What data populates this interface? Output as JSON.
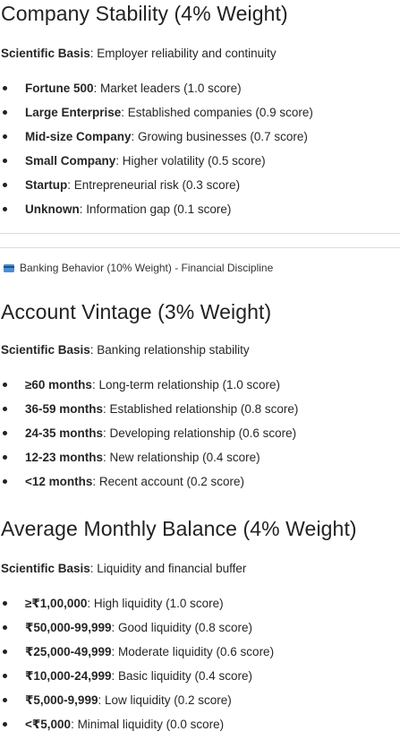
{
  "company_stability": {
    "heading": "Company Stability (4% Weight)",
    "basis_label": "Scientific Basis",
    "basis_text": ": Employer reliability and continuity",
    "items": [
      {
        "term": "Fortune 500",
        "desc": ": Market leaders (1.0 score)"
      },
      {
        "term": "Large Enterprise",
        "desc": ": Established companies (0.9 score)"
      },
      {
        "term": "Mid-size Company",
        "desc": ": Growing businesses (0.7 score)"
      },
      {
        "term": "Small Company",
        "desc": ": Higher volatility (0.5 score)"
      },
      {
        "term": "Startup",
        "desc": ": Entrepreneurial risk (0.3 score)"
      },
      {
        "term": "Unknown",
        "desc": ": Information gap (0.1 score)"
      }
    ]
  },
  "banking_banner": {
    "icon": "credit-card-icon",
    "text": "Banking Behavior (10% Weight) - Financial Discipline"
  },
  "account_vintage": {
    "heading": "Account Vintage (3% Weight)",
    "basis_label": "Scientific Basis",
    "basis_text": ": Banking relationship stability",
    "items": [
      {
        "term": "≥60 months",
        "desc": ": Long-term relationship (1.0 score)"
      },
      {
        "term": "36-59 months",
        "desc": ": Established relationship (0.8 score)"
      },
      {
        "term": "24-35 months",
        "desc": ": Developing relationship (0.6 score)"
      },
      {
        "term": "12-23 months",
        "desc": ": New relationship (0.4 score)"
      },
      {
        "term": "<12 months",
        "desc": ": Recent account (0.2 score)"
      }
    ]
  },
  "average_monthly_balance": {
    "heading": "Average Monthly Balance (4% Weight)",
    "basis_label": "Scientific Basis",
    "basis_text": ": Liquidity and financial buffer",
    "items": [
      {
        "term": "≥₹1,00,000",
        "desc": ": High liquidity (1.0 score)"
      },
      {
        "term": "₹50,000-99,999",
        "desc": ": Good liquidity (0.8 score)"
      },
      {
        "term": "₹25,000-49,999",
        "desc": ": Moderate liquidity (0.6 score)"
      },
      {
        "term": "₹10,000-24,999",
        "desc": ": Basic liquidity (0.4 score)"
      },
      {
        "term": "₹5,000-9,999",
        "desc": ": Low liquidity (0.2 score)"
      },
      {
        "term": "<₹5,000",
        "desc": ": Minimal liquidity (0.0 score)"
      }
    ]
  }
}
